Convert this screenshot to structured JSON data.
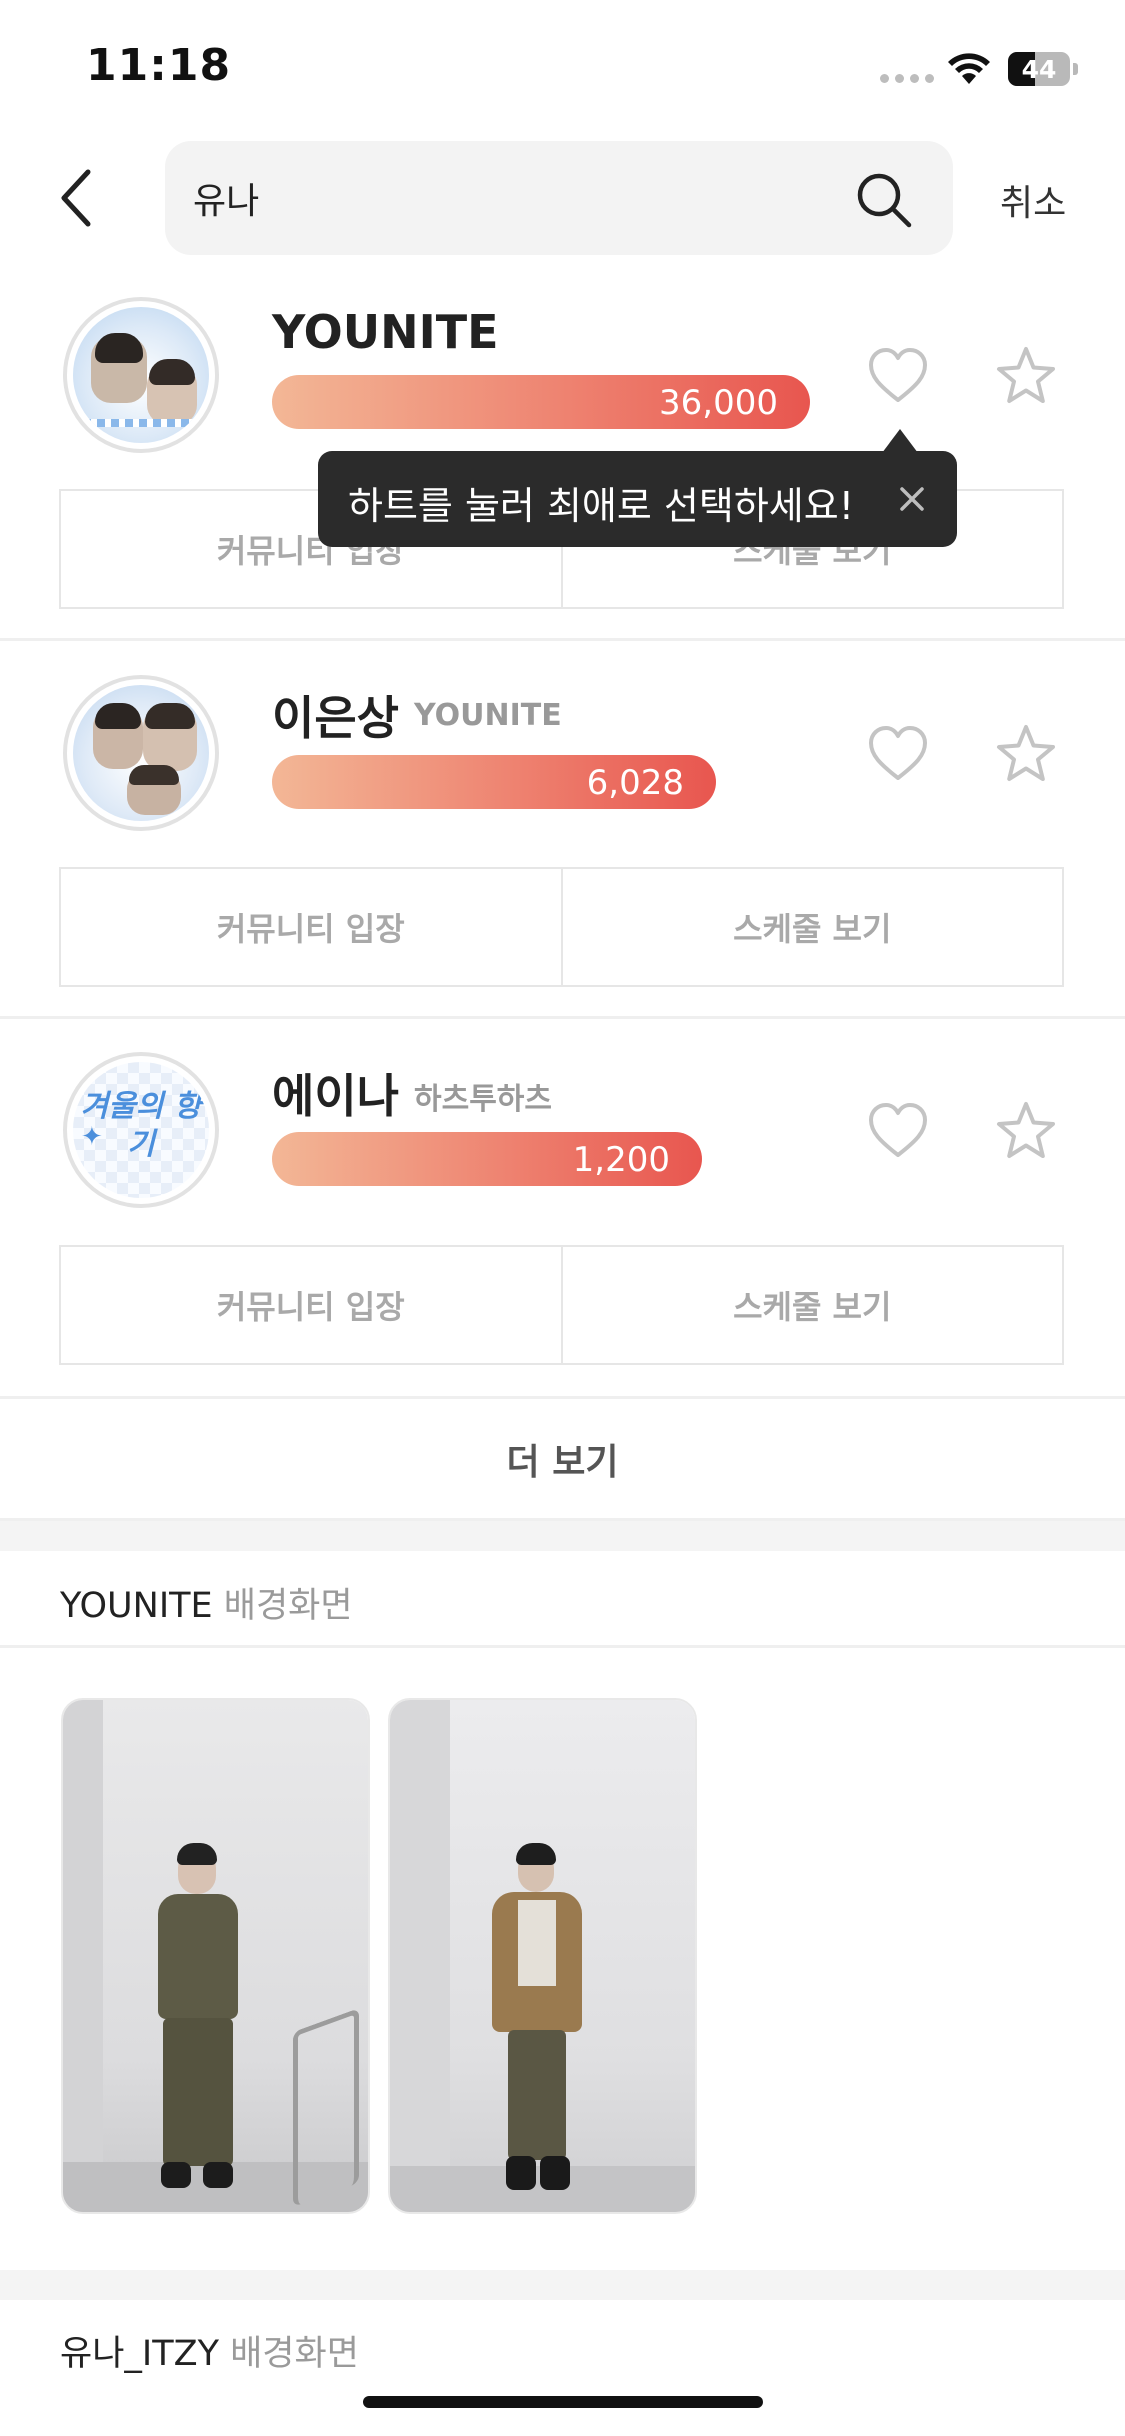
{
  "status_bar": {
    "time": "11:18",
    "battery": "44"
  },
  "search": {
    "query": "유나",
    "cancel_label": "취소"
  },
  "artists": [
    {
      "name": "YOUNITE",
      "group": "",
      "hearts": "36,000",
      "progress": 1.0
    },
    {
      "name": "이은상",
      "group": "YOUNITE",
      "hearts": "6,028",
      "progress": 0.84
    },
    {
      "name": "에이나",
      "group": "하츠투하츠",
      "hearts": "1,200",
      "progress": 0.81
    }
  ],
  "buttons": {
    "community": "커뮤니티 입장",
    "schedule": "스케줄 보기"
  },
  "tooltip": {
    "text": "하트를 눌러 최애로 선택하세요!"
  },
  "more_label": "더 보기",
  "wallpaper_sections": [
    {
      "title": "YOUNITE",
      "suffix": "배경화면"
    },
    {
      "title": "유나_ITZY",
      "suffix": "배경화면"
    }
  ],
  "avatar3_text": "겨울의 향기",
  "colors": {
    "bar_start": "#f3b796",
    "bar_end": "#e8564f",
    "tooltip_bg": "#2b2b2b"
  }
}
